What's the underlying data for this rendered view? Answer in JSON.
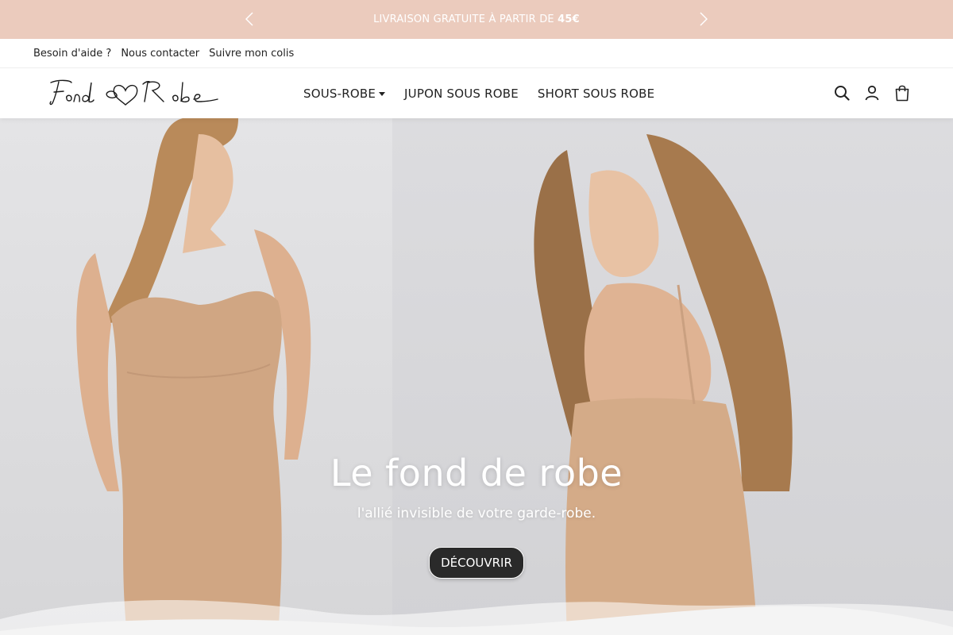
{
  "announcement": {
    "text": "LIVRAISON GRATUITE À PARTIR DE ",
    "highlight": "45€",
    "prev_icon": "chevron-left-icon",
    "next_icon": "chevron-right-icon"
  },
  "utility_links": [
    "Besoin d'aide ?",
    "Nous contacter",
    "Suivre mon colis"
  ],
  "brand": {
    "name": "Fond Robe"
  },
  "nav": {
    "items": [
      {
        "label": "SOUS-ROBE",
        "dropdown": true
      },
      {
        "label": "JUPON SOUS ROBE",
        "dropdown": false
      },
      {
        "label": "SHORT SOUS ROBE",
        "dropdown": false
      }
    ]
  },
  "header_icons": [
    "search-icon",
    "account-icon",
    "cart-icon"
  ],
  "hero": {
    "title": "Le fond de robe",
    "subtitle": "l'allié invisible de votre garde-robe.",
    "button": "DÉCOUVRIR"
  },
  "colors": {
    "announcement_bg": "#ebcbbd",
    "button_bg": "#2a2a2a",
    "text_dark": "#222222"
  }
}
